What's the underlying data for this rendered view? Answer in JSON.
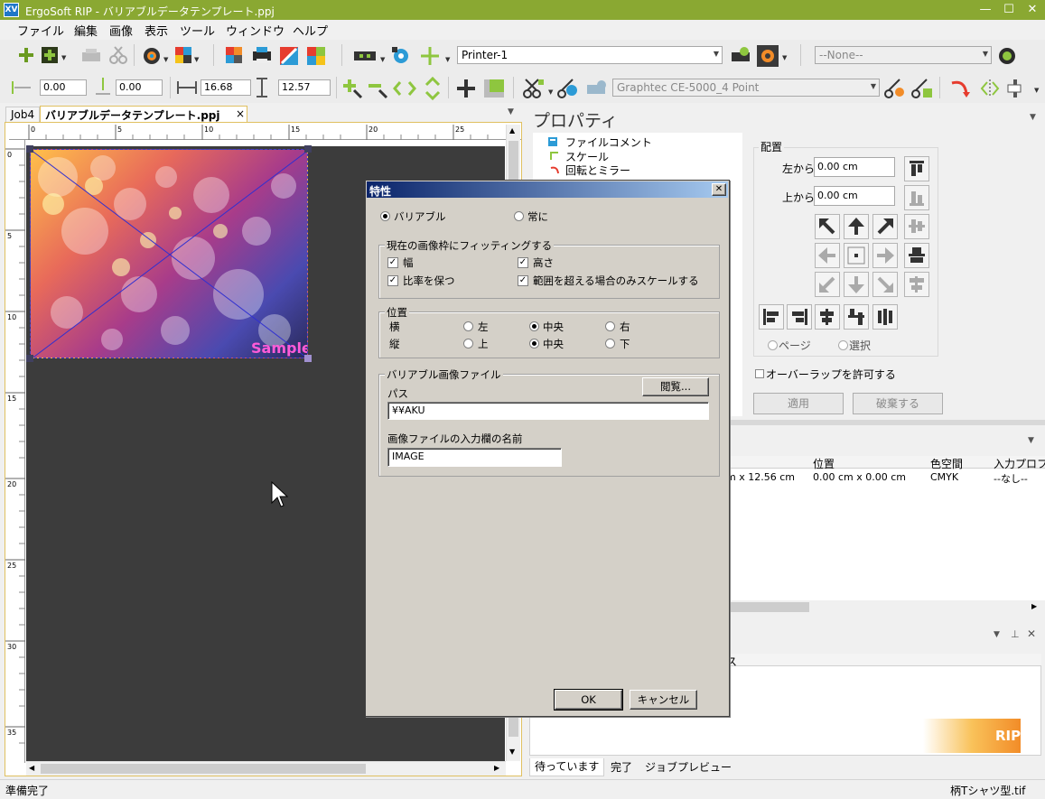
{
  "app": {
    "title": "ErgoSoft RIP - バリアブルデータテンプレート.ppj",
    "logo_text": "XV"
  },
  "menu": [
    "ファイル",
    "編集",
    "画像",
    "表示",
    "ツール",
    "ウィンドウ",
    "ヘルプ"
  ],
  "toolbar1": {
    "printer_select": "Printer-1",
    "none_select": "--None--"
  },
  "toolbar2": {
    "x_value": "0.00",
    "y_value": "0.00",
    "width_value": "16.68",
    "height_value": "12.57",
    "cutter_select": "Graphtec CE-5000_4 Point"
  },
  "tabs": [
    "Job4",
    "バリアブルデータテンプレート.ppj"
  ],
  "canvas": {
    "ruler_unit": "cm",
    "ruler_top_labels": [
      "0",
      "5",
      "10",
      "15",
      "20",
      "25"
    ],
    "ruler_left_labels": [
      "0",
      "5",
      "10",
      "15",
      "20",
      "25",
      "30",
      "35"
    ],
    "image_watermark": "Sample"
  },
  "properties": {
    "title": "プロパティ",
    "tree": [
      "ファイルコメント",
      "スケール",
      "回転とミラー"
    ],
    "layout_group": "配置",
    "from_left_label": "左から",
    "from_left_value": "0.00 cm",
    "from_top_label": "上から",
    "from_top_value": "0.00 cm",
    "ref_page": "ページ",
    "ref_selection": "選択",
    "overlap_label": "オーバーラップを許可する",
    "apply_button": "適用",
    "discard_button": "破棄する"
  },
  "job_table": {
    "columns": [
      "位置",
      "色空間",
      "入力プロフ"
    ],
    "row": {
      "size": "m x 12.56 cm",
      "position": "0.00 cm x 0.00 cm",
      "colorspace": "CMYK",
      "input_profile": "--なし--"
    }
  },
  "bottom_panel": {
    "partial_header": "ス",
    "tabs": [
      "待っています",
      "完了",
      "ジョブプレビュー"
    ],
    "rip_logo": "RIP"
  },
  "status": {
    "left": "準備完了",
    "right": "柄Tシャツ型.tif"
  },
  "dialog": {
    "title": "特性",
    "close": "✕",
    "radio_variable": "バリアブル",
    "radio_always": "常に",
    "fit_group": "現在の画像枠にフィッティングする",
    "chk_width": "幅",
    "chk_height": "高さ",
    "chk_keep_ratio": "比率を保つ",
    "chk_scale_only_exceed": "範囲を超える場合のみスケールする",
    "position_group": "位置",
    "horizontal": "横",
    "vertical": "縦",
    "pos_left": "左",
    "pos_center": "中央",
    "pos_right": "右",
    "pos_top": "上",
    "pos_vcenter": "中央",
    "pos_bottom": "下",
    "file_group": "バリアブル画像ファイル",
    "path_label": "パス",
    "browse_button": "閲覧...",
    "path_value": "¥¥AKU",
    "field_name_label": "画像ファイルの入力欄の名前",
    "field_name_value": "IMAGE",
    "ok_button": "OK",
    "cancel_button": "キャンセル"
  }
}
